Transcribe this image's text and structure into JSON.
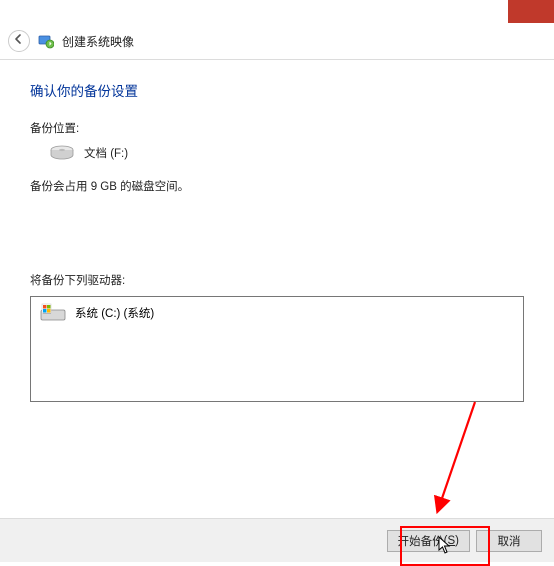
{
  "titlebar": {
    "close": "✕"
  },
  "header": {
    "title": "创建系统映像"
  },
  "content": {
    "heading": "确认你的备份设置",
    "backup_location_label": "备份位置:",
    "backup_location_value": "文档 (F:)",
    "backup_size_text": "备份会占用 9 GB 的磁盘空间。",
    "drives_label": "将备份下列驱动器:",
    "drives": [
      {
        "label": "系统 (C:) (系统)"
      }
    ]
  },
  "footer": {
    "start": "开始备份",
    "start_accel": "S",
    "cancel": "取消"
  }
}
